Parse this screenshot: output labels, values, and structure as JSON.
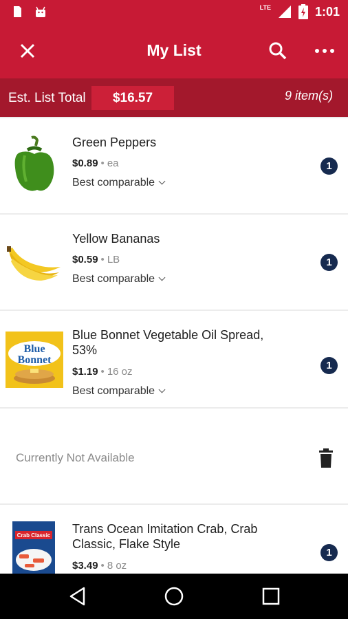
{
  "status_bar": {
    "time": "1:01",
    "network": "LTE",
    "icons": [
      "sd-card-icon",
      "android-icon",
      "signal-icon",
      "battery-charging-icon"
    ]
  },
  "app_bar": {
    "title": "My List",
    "icons": [
      "close-icon",
      "search-icon",
      "more-icon"
    ]
  },
  "summary": {
    "total_label": "Est. List Total",
    "total_value": "$16.57",
    "item_count": "9 item(s)"
  },
  "items": [
    {
      "name": "Green Peppers",
      "price": "$0.89",
      "unit": "ea",
      "compare": "Best comparable",
      "qty": "1"
    },
    {
      "name": "Yellow Bananas",
      "price": "$0.59",
      "unit": "LB",
      "compare": "Best comparable",
      "qty": "1"
    },
    {
      "name": "Blue Bonnet Vegetable Oil Spread, 53%",
      "price": "$1.19",
      "unit": "16 oz",
      "compare": "Best comparable",
      "qty": "1",
      "image_text": [
        "Blue",
        "Bonnet"
      ]
    },
    {
      "unavailable_text": "Currently Not Available"
    },
    {
      "name": "Trans Ocean Imitation Crab, Crab Classic, Flake Style",
      "price": "$3.49",
      "unit": "8 oz",
      "qty": "1",
      "image_text": "Crab Classic"
    }
  ],
  "nav": {
    "icons": [
      "back-icon",
      "home-icon",
      "recents-icon"
    ]
  },
  "colors": {
    "brand_red": "#c71a35",
    "dark_red": "#a3182c",
    "badge_navy": "#162a4f"
  }
}
